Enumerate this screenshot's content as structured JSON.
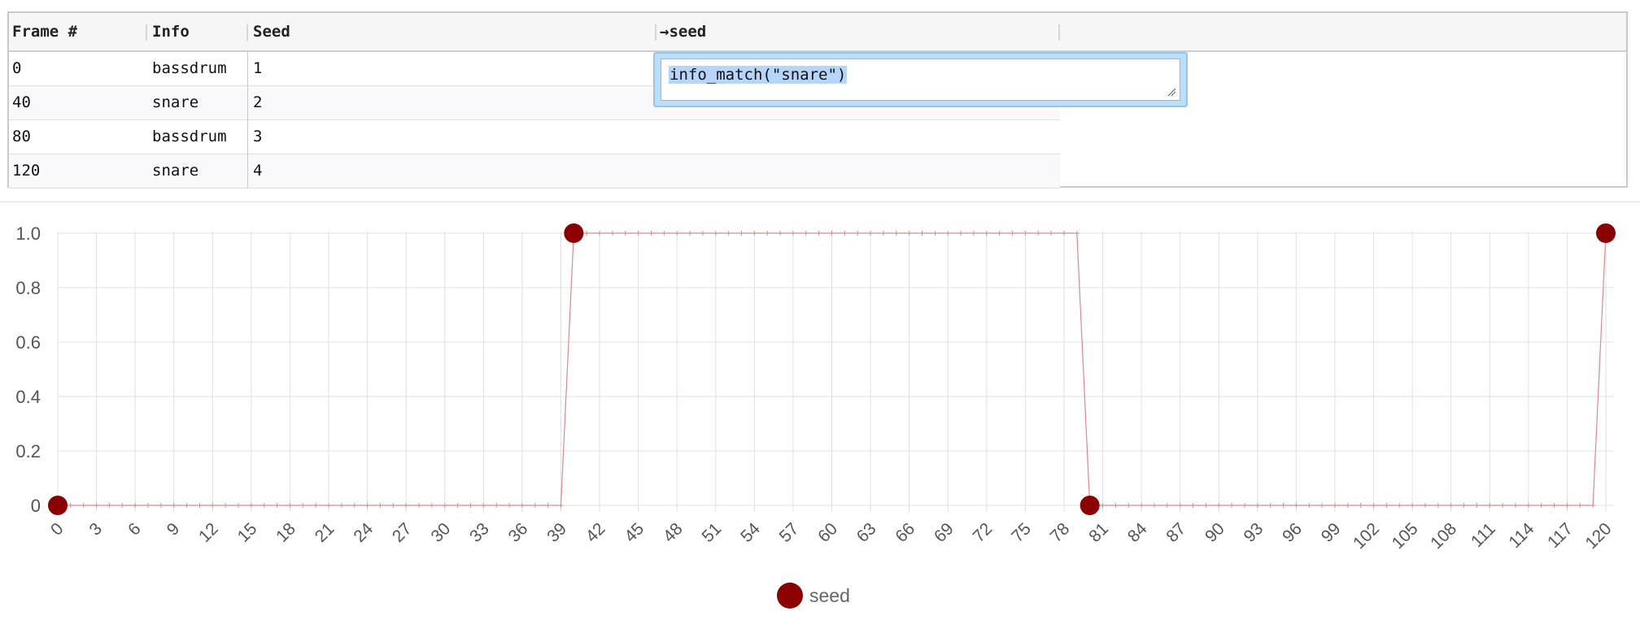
{
  "table": {
    "columns": [
      "Frame #",
      "Info",
      "Seed",
      "→seed"
    ],
    "rows": [
      {
        "frame": "0",
        "info": "bassdrum",
        "seed": "1"
      },
      {
        "frame": "40",
        "info": "snare",
        "seed": "2"
      },
      {
        "frame": "80",
        "info": "bassdrum",
        "seed": "3"
      },
      {
        "frame": "120",
        "info": "snare",
        "seed": "4"
      }
    ]
  },
  "editor": {
    "expression": "info_match(\"snare\")"
  },
  "colors": {
    "series": "#8b0000",
    "line": "#d98a8a",
    "grid": "#e0e0e6"
  },
  "chart_data": {
    "type": "line",
    "x_range": [
      0,
      120
    ],
    "ylim": [
      0,
      1
    ],
    "y_ticks": [
      "0",
      "0.2",
      "0.4",
      "0.6",
      "0.8",
      "1.0"
    ],
    "x_ticks": [
      "0",
      "3",
      "6",
      "9",
      "12",
      "15",
      "18",
      "21",
      "24",
      "27",
      "30",
      "33",
      "36",
      "39",
      "42",
      "45",
      "48",
      "51",
      "54",
      "57",
      "60",
      "63",
      "66",
      "69",
      "72",
      "75",
      "78",
      "81",
      "84",
      "87",
      "90",
      "93",
      "96",
      "99",
      "102",
      "105",
      "108",
      "111",
      "114",
      "117",
      "120"
    ],
    "series": [
      {
        "name": "seed",
        "segments": [
          {
            "x_from": 0,
            "x_to": 39,
            "value": 0
          },
          {
            "x_from": 40,
            "x_to": 79,
            "value": 1
          },
          {
            "x_from": 80,
            "x_to": 119,
            "value": 0
          },
          {
            "x_from": 120,
            "x_to": 120,
            "value": 1
          }
        ],
        "keyframes": [
          {
            "x": 0,
            "y": 0
          },
          {
            "x": 40,
            "y": 1
          },
          {
            "x": 80,
            "y": 0
          },
          {
            "x": 120,
            "y": 1
          }
        ]
      }
    ],
    "legend": {
      "label": "seed",
      "position": "bottom-center"
    }
  }
}
